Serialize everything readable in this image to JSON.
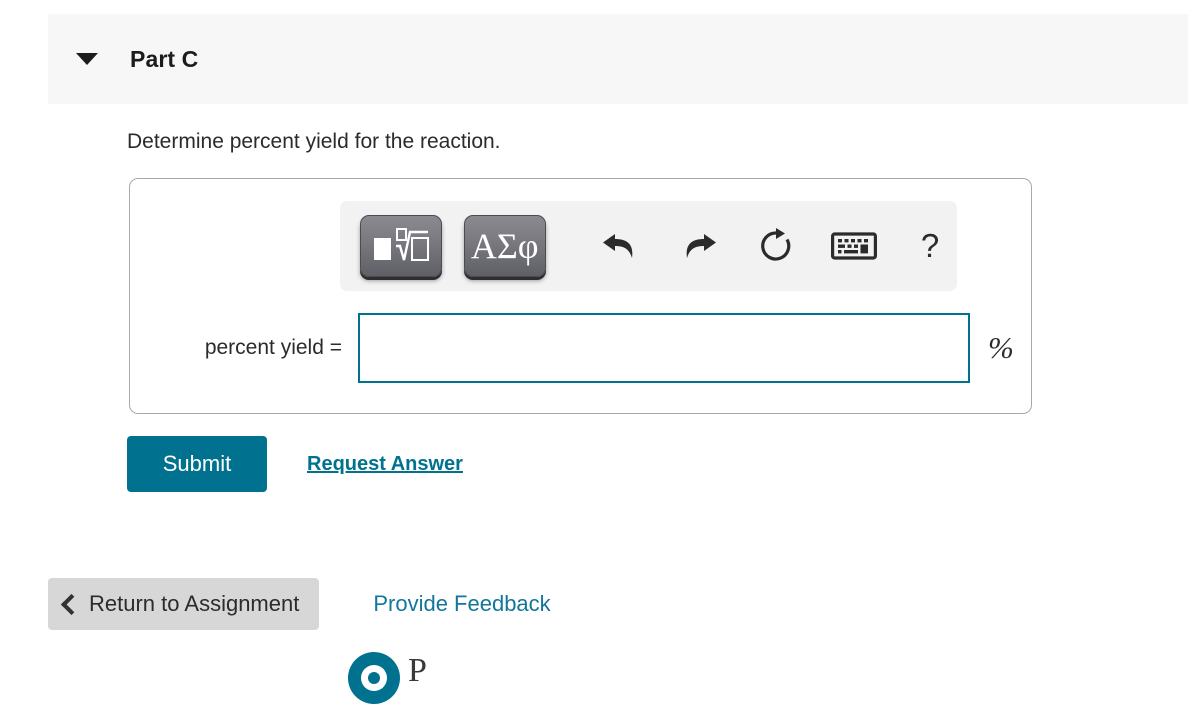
{
  "part": {
    "title": "Part C",
    "collapse_icon": "caret-down-icon"
  },
  "prompt": "Determine percent yield for the reaction.",
  "toolbar": {
    "template_button_label": "",
    "template_button_icon": "math-template-nth-root-icon",
    "greek_button_label": "ΑΣφ",
    "undo_icon": "undo-arrow-icon",
    "redo_icon": "redo-arrow-icon",
    "reset_icon": "reset-circular-arrow-icon",
    "keyboard_icon": "keyboard-icon",
    "help_label": "?"
  },
  "answer": {
    "label": "percent yield =",
    "value": "",
    "placeholder": "",
    "unit": "%"
  },
  "actions": {
    "submit_label": "Submit",
    "request_answer_label": "Request Answer"
  },
  "footer": {
    "return_label": "Return to Assignment",
    "return_icon": "chevron-left-icon",
    "feedback_label": "Provide Feedback",
    "logo_word": "P"
  },
  "colors": {
    "accent_teal": "#00718e",
    "link_teal": "#13769a",
    "header_band": "#f7f7f7",
    "panel_border": "#a9a9a9",
    "toolbar_bg": "#f2f2f2",
    "return_button": "#d7d7d7"
  }
}
